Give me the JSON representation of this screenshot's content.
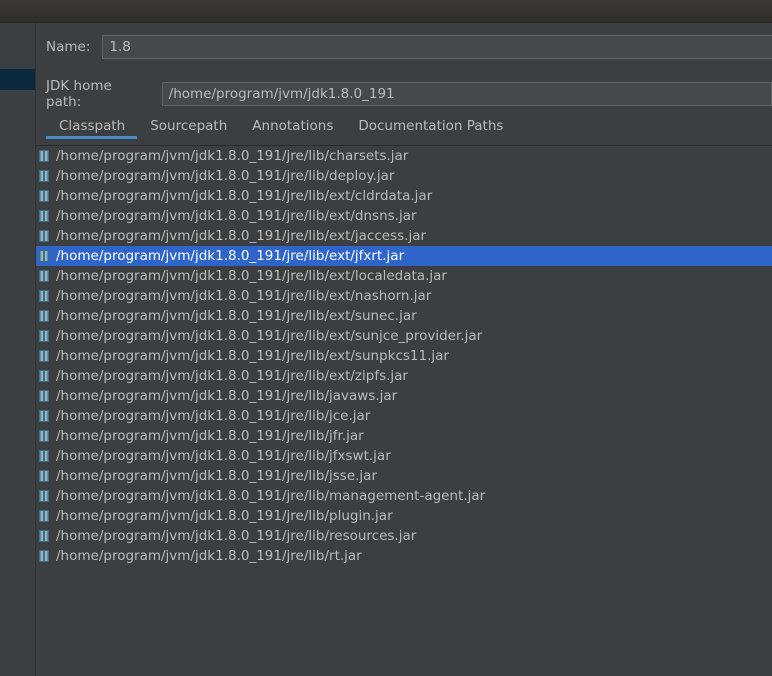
{
  "name_field": {
    "label": "Name:",
    "value": "1.8"
  },
  "jdk_field": {
    "label": "JDK home path:",
    "value": "/home/program/jvm/jdk1.8.0_191"
  },
  "tabs": [
    {
      "label": "Classpath",
      "active": true
    },
    {
      "label": "Sourcepath",
      "active": false
    },
    {
      "label": "Annotations",
      "active": false
    },
    {
      "label": "Documentation Paths",
      "active": false
    }
  ],
  "classpath": [
    "/home/program/jvm/jdk1.8.0_191/jre/lib/charsets.jar",
    "/home/program/jvm/jdk1.8.0_191/jre/lib/deploy.jar",
    "/home/program/jvm/jdk1.8.0_191/jre/lib/ext/cldrdata.jar",
    "/home/program/jvm/jdk1.8.0_191/jre/lib/ext/dnsns.jar",
    "/home/program/jvm/jdk1.8.0_191/jre/lib/ext/jaccess.jar",
    "/home/program/jvm/jdk1.8.0_191/jre/lib/ext/jfxrt.jar",
    "/home/program/jvm/jdk1.8.0_191/jre/lib/ext/localedata.jar",
    "/home/program/jvm/jdk1.8.0_191/jre/lib/ext/nashorn.jar",
    "/home/program/jvm/jdk1.8.0_191/jre/lib/ext/sunec.jar",
    "/home/program/jvm/jdk1.8.0_191/jre/lib/ext/sunjce_provider.jar",
    "/home/program/jvm/jdk1.8.0_191/jre/lib/ext/sunpkcs11.jar",
    "/home/program/jvm/jdk1.8.0_191/jre/lib/ext/zipfs.jar",
    "/home/program/jvm/jdk1.8.0_191/jre/lib/javaws.jar",
    "/home/program/jvm/jdk1.8.0_191/jre/lib/jce.jar",
    "/home/program/jvm/jdk1.8.0_191/jre/lib/jfr.jar",
    "/home/program/jvm/jdk1.8.0_191/jre/lib/jfxswt.jar",
    "/home/program/jvm/jdk1.8.0_191/jre/lib/jsse.jar",
    "/home/program/jvm/jdk1.8.0_191/jre/lib/management-agent.jar",
    "/home/program/jvm/jdk1.8.0_191/jre/lib/plugin.jar",
    "/home/program/jvm/jdk1.8.0_191/jre/lib/resources.jar",
    "/home/program/jvm/jdk1.8.0_191/jre/lib/rt.jar"
  ],
  "selected_index": 5,
  "icon": "jar-archive-icon",
  "colors": {
    "background": "#3c3f41",
    "selection": "#2f65ca",
    "tab_underline": "#4a88c7",
    "text": "#bbbbbb"
  }
}
